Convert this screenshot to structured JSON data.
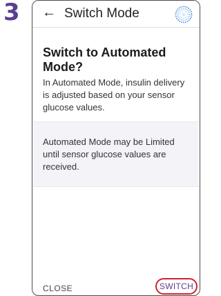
{
  "step_number": "3",
  "header": {
    "back_icon": "left-arrow-icon",
    "title": "Switch Mode",
    "status_icon": "automated-mode-circle-icon"
  },
  "dialog": {
    "title": "Switch to Automated Mode?",
    "description": "In Automated Mode, insulin delivery is adjusted based on your sensor glucose values.",
    "note": "Automated Mode may be Limited until sensor glucose values are received."
  },
  "actions": {
    "close_label": "CLOSE",
    "switch_label": "SWITCH"
  },
  "colors": {
    "step_number": "#5a3f8f",
    "switch_text": "#5a3f8f",
    "highlight_ring": "#d0202e",
    "note_background": "#f3f3f8",
    "mode_icon": "#4a8fe0"
  }
}
